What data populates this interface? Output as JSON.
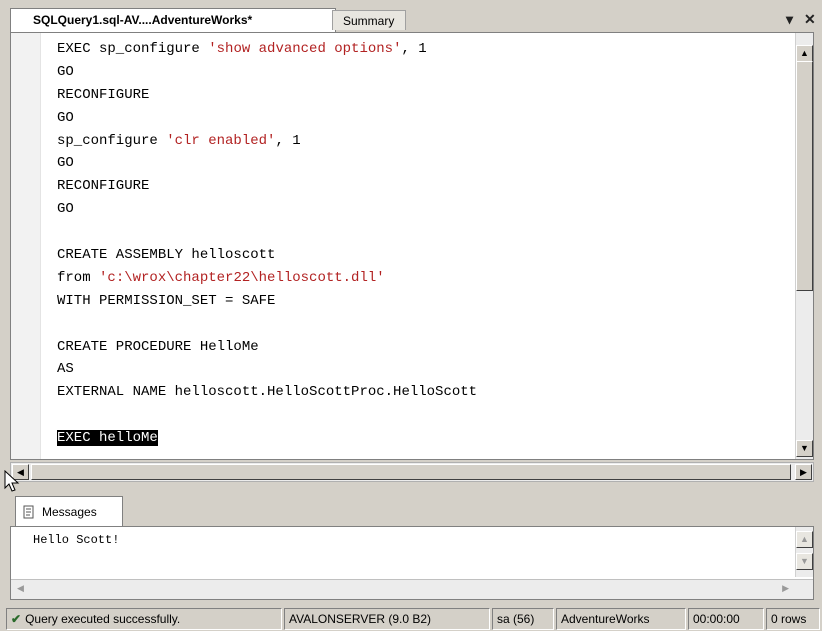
{
  "tabs": {
    "active_label": "SQLQuery1.sql-AV....AdventureWorks*",
    "inactive_label": "Summary",
    "dropdown_glyph": "▾",
    "close_glyph": "✕"
  },
  "editor": {
    "lines": [
      {
        "text": "EXEC sp_configure 'show advanced options', 1"
      },
      {
        "text": "GO"
      },
      {
        "text": "RECONFIGURE"
      },
      {
        "text": "GO"
      },
      {
        "text": "sp_configure 'clr enabled', 1"
      },
      {
        "text": "GO"
      },
      {
        "text": "RECONFIGURE"
      },
      {
        "text": "GO"
      },
      {
        "text": ""
      },
      {
        "text": "CREATE ASSEMBLY helloscott"
      },
      {
        "text": "from 'c:\\wrox\\chapter22\\helloscott.dll'"
      },
      {
        "text": "WITH PERMISSION_SET = SAFE"
      },
      {
        "text": ""
      },
      {
        "text": "CREATE PROCEDURE HelloMe"
      },
      {
        "text": "AS"
      },
      {
        "text": "EXTERNAL NAME helloscott.HelloScottProc.HelloScott"
      },
      {
        "text": ""
      },
      {
        "text": "EXEC helloMe",
        "selected": true
      }
    ]
  },
  "results": {
    "tab_label": "Messages",
    "output": "Hello Scott!"
  },
  "status": {
    "message": "Query executed successfully.",
    "server": "AVALONSERVER (9.0 B2)",
    "user": "sa (56)",
    "database": "AdventureWorks",
    "elapsed": "00:00:00",
    "rows": "0 rows"
  },
  "colors": {
    "chrome": "#d4d0c8",
    "string_literal": "#b22222",
    "selection_bg": "#000000",
    "success_check": "#2a6a2a"
  },
  "icons": [
    "close-icon",
    "dropdown-icon",
    "scroll-up-icon",
    "scroll-down-icon",
    "scroll-left-icon",
    "scroll-right-icon",
    "messages-icon",
    "success-check-icon",
    "mouse-cursor-icon"
  ]
}
